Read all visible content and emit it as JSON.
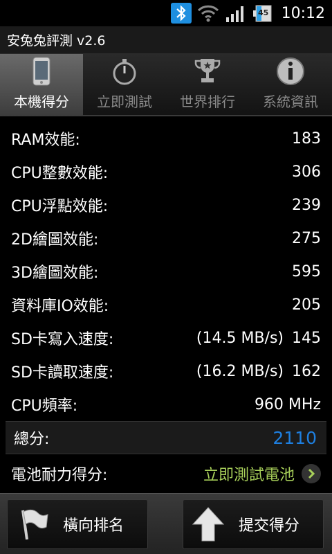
{
  "status_bar": {
    "icons": [
      "bluetooth-icon",
      "wifi-icon",
      "signal-icon",
      "battery-icon"
    ],
    "battery_level": "45",
    "time": "10:12"
  },
  "app": {
    "title": "安兔兔評測 v2.6"
  },
  "tabs": [
    {
      "label": "本機得分",
      "icon": "phone-icon",
      "active": true
    },
    {
      "label": "立即測試",
      "icon": "stopwatch-icon",
      "active": false
    },
    {
      "label": "世界排行",
      "icon": "trophy-icon",
      "active": false
    },
    {
      "label": "系統資訊",
      "icon": "info-icon",
      "active": false
    }
  ],
  "scores": [
    {
      "label": "RAM效能:",
      "extra": "",
      "value": "183"
    },
    {
      "label": "CPU整數效能:",
      "extra": "",
      "value": "306"
    },
    {
      "label": "CPU浮點效能:",
      "extra": "",
      "value": "239"
    },
    {
      "label": "2D繪圖效能:",
      "extra": "",
      "value": "275"
    },
    {
      "label": "3D繪圖效能:",
      "extra": "",
      "value": "595"
    },
    {
      "label": "資料庫IO效能:",
      "extra": "",
      "value": "205"
    },
    {
      "label": "SD卡寫入速度:",
      "extra": "(14.5 MB/s)",
      "value": "145"
    },
    {
      "label": "SD卡讀取速度:",
      "extra": "(16.2 MB/s)",
      "value": "162"
    },
    {
      "label": "CPU頻率:",
      "extra": "",
      "value": "960 MHz"
    }
  ],
  "total": {
    "label": "總分:",
    "value": "2110"
  },
  "battery_test": {
    "label": "電池耐力得分:",
    "link": "立即測試電池"
  },
  "bottom_buttons": {
    "left": {
      "label": "橫向排名",
      "icon": "flag-icon"
    },
    "right": {
      "label": "提交得分",
      "icon": "upload-arrow-icon"
    }
  },
  "colors": {
    "accent_blue": "#1e7fe0",
    "link_green": "#a8d05a",
    "bluetooth_blue": "#1e8fe0"
  }
}
